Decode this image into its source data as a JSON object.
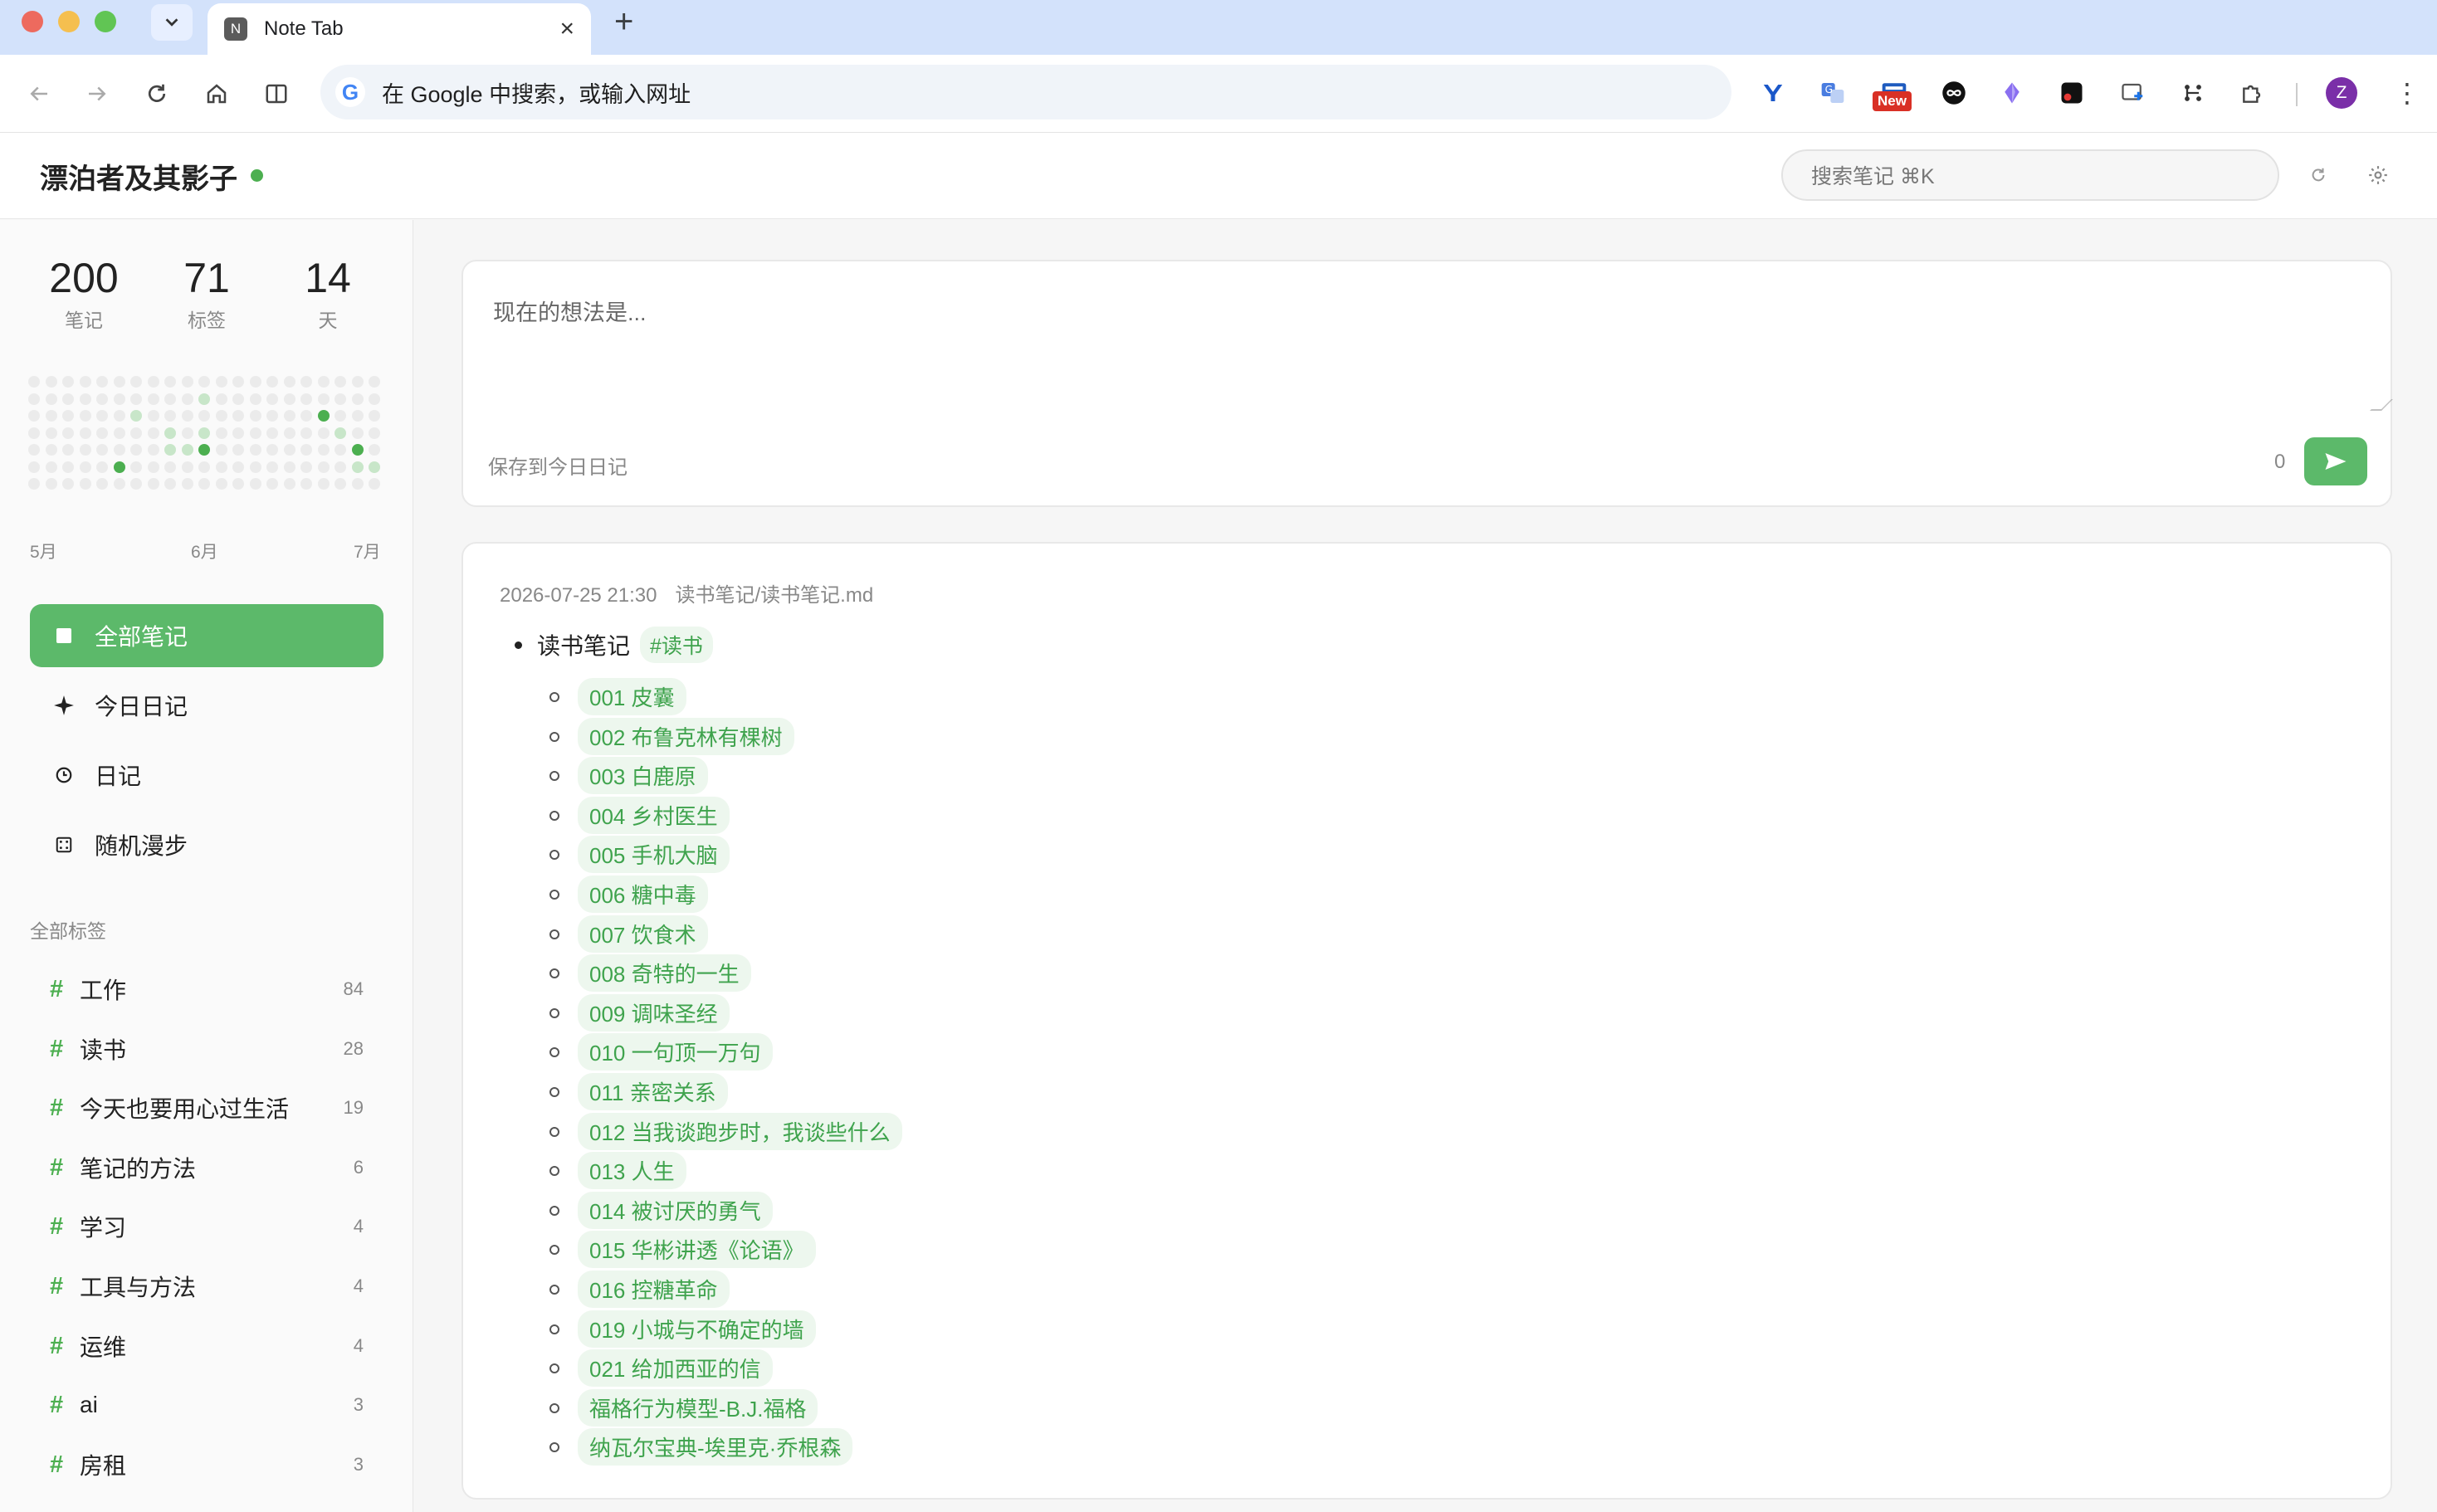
{
  "browser": {
    "tab_title": "Note Tab",
    "tab_favicon_letter": "N",
    "omnibox_text": "在 Google 中搜索，或输入网址",
    "new_badge": "New",
    "profile_initial": "Z"
  },
  "app": {
    "title": "漂泊者及其影子",
    "search_placeholder": "搜索笔记  ⌘K"
  },
  "stats": [
    {
      "value": "200",
      "label": "笔记"
    },
    {
      "value": "71",
      "label": "标签"
    },
    {
      "value": "14",
      "label": "天"
    }
  ],
  "heatmap_months": [
    "5月",
    "6月",
    "7月"
  ],
  "nav": [
    {
      "label": "全部笔记",
      "icon": "square-icon",
      "active": true
    },
    {
      "label": "今日日记",
      "icon": "sparkle-icon",
      "active": false
    },
    {
      "label": "日记",
      "icon": "clock-icon",
      "active": false
    },
    {
      "label": "随机漫步",
      "icon": "dice-icon",
      "active": false
    }
  ],
  "tags_section_label": "全部标签",
  "tags": [
    {
      "hash": "#",
      "name": "工作",
      "count": "84"
    },
    {
      "hash": "#",
      "name": "读书",
      "count": "28"
    },
    {
      "hash": "#",
      "name": "今天也要用心过生活",
      "count": "19"
    },
    {
      "hash": "#",
      "name": "笔记的方法",
      "count": "6"
    },
    {
      "hash": "#",
      "name": "学习",
      "count": "4"
    },
    {
      "hash": "#",
      "name": "工具与方法",
      "count": "4"
    },
    {
      "hash": "#",
      "name": "运维",
      "count": "4"
    },
    {
      "hash": "#",
      "name": "ai",
      "count": "3"
    },
    {
      "hash": "#",
      "name": "房租",
      "count": "3"
    }
  ],
  "composer": {
    "placeholder": "现在的想法是...",
    "save_label": "保存到今日日记",
    "char_count": "0"
  },
  "note": {
    "timestamp": "2026-07-25 21:30",
    "path": "读书笔记/读书笔记.md",
    "title": "读书笔记",
    "tag": "#读书",
    "links": [
      "001 皮囊",
      "002 布鲁克林有棵树",
      "003 白鹿原",
      "004 乡村医生",
      "005 手机大脑",
      "006 糖中毒",
      "007 饮食术",
      "008 奇特的一生",
      "009 调味圣经",
      "010 一句顶一万句",
      "011 亲密关系",
      "012 当我谈跑步时，我谈些什么",
      "013 人生",
      "014 被讨厌的勇气",
      "015 华彬讲透《论语》",
      "016 控糖革命",
      "019 小城与不确定的墙",
      "021 给加西亚的信",
      "福格行为模型-B.J.福格",
      "纳瓦尔宝典-埃里克·乔根森"
    ]
  },
  "colors": {
    "accent": "#5cb96a",
    "tag_text": "#3fa34d",
    "tag_bg": "#edf7ee",
    "heat_dark": "#4caf50",
    "heat_light": "#c8e6c9",
    "heat_empty": "#ebebeb"
  }
}
